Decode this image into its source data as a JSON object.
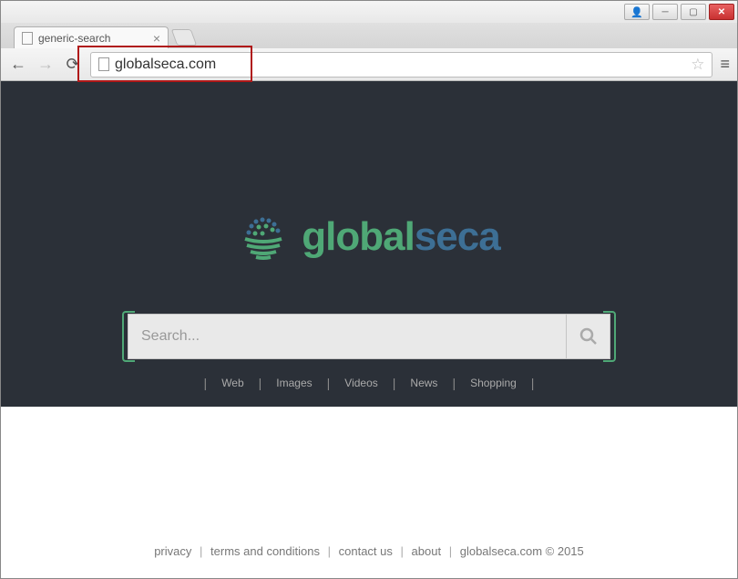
{
  "window": {
    "tab_title": "generic-search",
    "address": "globalseca.com"
  },
  "logo": {
    "part1": "global",
    "part2": "seca"
  },
  "search": {
    "placeholder": "Search...",
    "value": ""
  },
  "nav": {
    "items": [
      "Web",
      "Images",
      "Videos",
      "News",
      "Shopping"
    ]
  },
  "footer": {
    "links": [
      "privacy",
      "terms and conditions",
      "contact us",
      "about"
    ],
    "copyright": "globalseca.com © 2015"
  },
  "colors": {
    "hero_bg": "#2b3038",
    "brand_green": "#4fa876",
    "brand_blue": "#3d6f95",
    "highlight": "#b01818"
  }
}
